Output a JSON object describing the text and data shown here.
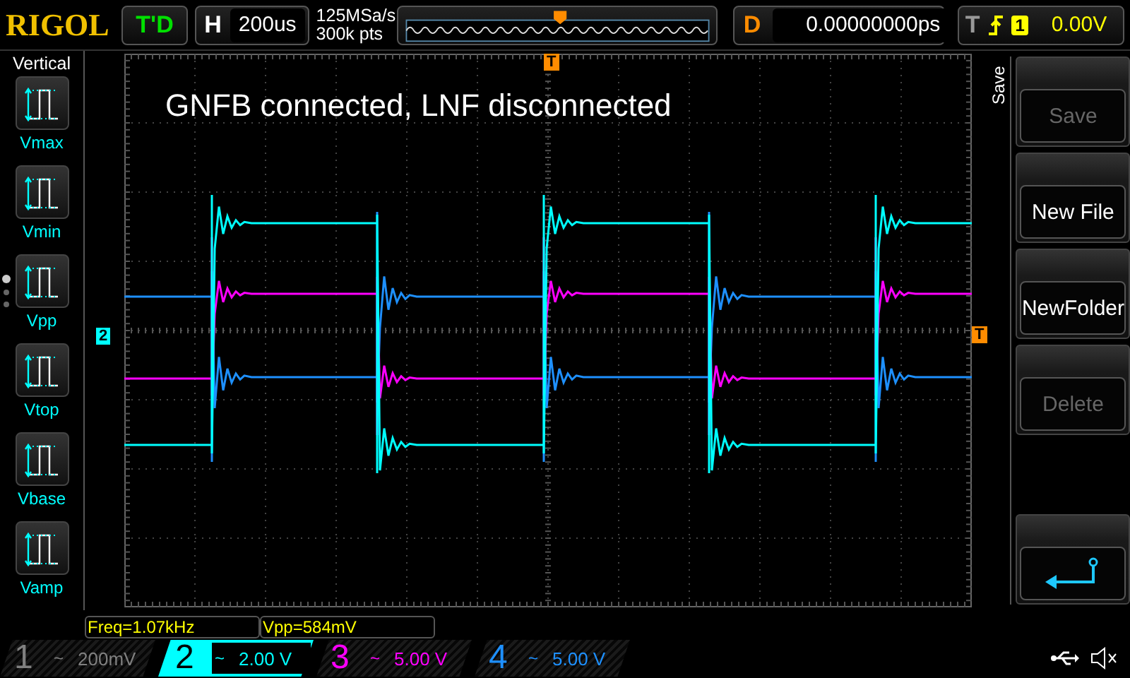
{
  "brand": "RIGOL",
  "run_status": "T'D",
  "horizontal": {
    "label": "H",
    "timebase": "200us"
  },
  "acquisition": {
    "sample_rate": "125MSa/s",
    "memory_depth": "300k pts"
  },
  "delay": {
    "label": "D",
    "value": "0.00000000ps"
  },
  "trigger": {
    "label": "T",
    "source": "1",
    "level": "0.00V"
  },
  "measure_menu": {
    "title": "Vertical",
    "items": [
      {
        "label": "Vmax"
      },
      {
        "label": "Vmin"
      },
      {
        "label": "Vpp"
      },
      {
        "label": "Vtop"
      },
      {
        "label": "Vbase"
      },
      {
        "label": "Vamp"
      }
    ]
  },
  "screen": {
    "annotation": "GNFB connected, LNF disconnected",
    "trigger_position_marker": "T",
    "trigger_level_marker": "T",
    "channel_marker": "2"
  },
  "save_menu": {
    "title": "Save",
    "buttons": [
      {
        "kind": "text",
        "label": "Save",
        "disabled": true
      },
      {
        "kind": "text",
        "label": "New File",
        "disabled": false
      },
      {
        "kind": "text",
        "label": "NewFolder",
        "disabled": false
      },
      {
        "kind": "text",
        "label": "Delete",
        "disabled": true
      },
      {
        "kind": "return",
        "disabled": false
      }
    ]
  },
  "measurements": [
    "Freq=1.07kHz",
    "Vpp=584mV"
  ],
  "channels": [
    {
      "number": "1",
      "coupling": "~",
      "scale": "200mV",
      "selected": false,
      "color": "#808080"
    },
    {
      "number": "2",
      "coupling": "~",
      "scale": "2.00 V",
      "selected": true,
      "color": "#00ffff"
    },
    {
      "number": "3",
      "coupling": "~",
      "scale": "5.00 V",
      "selected": false,
      "color": "#ff00ff"
    },
    {
      "number": "4",
      "coupling": "~",
      "scale": "5.00 V",
      "selected": false,
      "color": "#1e90ff"
    }
  ]
}
